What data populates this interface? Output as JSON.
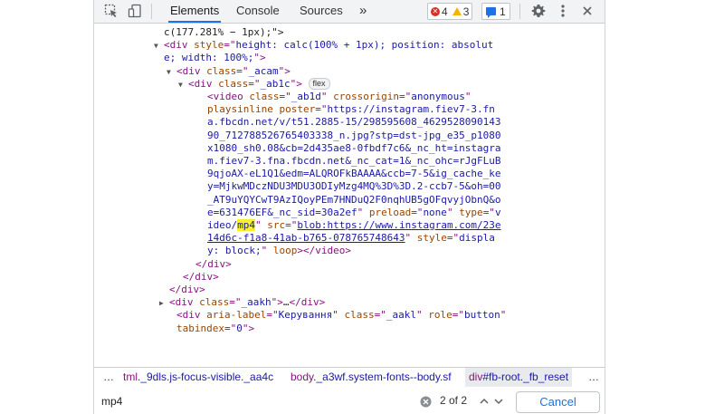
{
  "toolbar": {
    "tabs": [
      "Elements",
      "Console",
      "Sources"
    ],
    "more_tabs": "»",
    "errors": "4",
    "warnings": "3",
    "messages": "1"
  },
  "tree": [
    {
      "parts": [
        [
          "t",
          "c(177.281% − 1px);\">"
        ]
      ]
    },
    {
      "parts": [
        [
          "tri",
          "▼"
        ],
        [
          "tag",
          "<div "
        ],
        [
          "an",
          "style"
        ],
        [
          "tag",
          "=\""
        ],
        [
          "av",
          "height: calc(100% + 1px); position: absolut"
        ]
      ]
    },
    {
      "parts": [
        [
          "av",
          "e; width: 100%;"
        ],
        [
          "tag",
          "\">"
        ]
      ]
    },
    {
      "parts": [
        [
          "tri",
          "▼"
        ],
        [
          "tag",
          "<div "
        ],
        [
          "an",
          "class"
        ],
        [
          "tag",
          "=\""
        ],
        [
          "av",
          "_acam"
        ],
        [
          "tag",
          "\">"
        ]
      ]
    },
    {
      "parts": [
        [
          "tri",
          "▼"
        ],
        [
          "tag",
          "<div "
        ],
        [
          "an",
          "class"
        ],
        [
          "tag",
          "=\""
        ],
        [
          "av",
          "_ab1c"
        ],
        [
          "tag",
          "\">"
        ],
        [
          "t",
          " "
        ],
        [
          "pill",
          "flex"
        ]
      ]
    },
    {
      "parts": [
        [
          "tag",
          "<video "
        ],
        [
          "an",
          "class"
        ],
        [
          "tag",
          "=\""
        ],
        [
          "av",
          "_ab1d"
        ],
        [
          "tag",
          "\" "
        ],
        [
          "an",
          "crossorigin"
        ],
        [
          "tag",
          "=\""
        ],
        [
          "av",
          "anonymous"
        ],
        [
          "tag",
          "\""
        ]
      ]
    },
    {
      "parts": [
        [
          "an",
          "playsinline "
        ],
        [
          "an",
          "poster"
        ],
        [
          "tag",
          "=\""
        ],
        [
          "av",
          "https://instagram.fiev7-3.fn"
        ]
      ]
    },
    {
      "parts": [
        [
          "av",
          "a.fbcdn.net/v/t51.2885-15/298595608_4629528090143"
        ]
      ]
    },
    {
      "parts": [
        [
          "av",
          "90_712788526765403338_n.jpg?stp=dst-jpg_e35_p1080"
        ]
      ]
    },
    {
      "parts": [
        [
          "av",
          "x1080_sh0.08&cb=2d435ae8-0fbdf7c6&_nc_ht=instagra"
        ]
      ]
    },
    {
      "parts": [
        [
          "av",
          "m.fiev7-3.fna.fbcdn.net&_nc_cat=1&_nc_ohc=rJgFLuB"
        ]
      ]
    },
    {
      "parts": [
        [
          "av",
          "9qjoAX-eL1Q1&edm=ALQROFkBAAAA&ccb=7-5&ig_cache_ke"
        ]
      ]
    },
    {
      "parts": [
        [
          "av",
          "y=MjkwMDczNDU3MDU3ODIyMzg4MQ%3D%3D.2-ccb7-5&oh=00"
        ]
      ]
    },
    {
      "parts": [
        [
          "av",
          "_AT9uYQYCwT9AzIQoyPEm7HNDuQ2F0nqhUB5gOFqvyjObnQ&o"
        ]
      ]
    },
    {
      "parts": [
        [
          "av",
          "e=631476EF&_nc_sid=30a2ef"
        ],
        [
          "tag",
          "\" "
        ],
        [
          "an",
          "preload"
        ],
        [
          "tag",
          "=\""
        ],
        [
          "av",
          "none"
        ],
        [
          "tag",
          "\" "
        ],
        [
          "an",
          "type"
        ],
        [
          "tag",
          "=\""
        ],
        [
          "av",
          "v"
        ]
      ]
    },
    {
      "parts": [
        [
          "av",
          "ideo/"
        ],
        [
          "hl",
          "mp4"
        ],
        [
          "tag",
          "\" "
        ],
        [
          "an",
          "src"
        ],
        [
          "tag",
          "=\""
        ],
        [
          "link",
          "blob:https://www.instagram.com/23e"
        ]
      ]
    },
    {
      "parts": [
        [
          "link",
          "14d6c-f1a8-41ab-b765-078765748643"
        ],
        [
          "tag",
          "\" "
        ],
        [
          "an",
          "style"
        ],
        [
          "tag",
          "=\""
        ],
        [
          "av",
          "displa"
        ]
      ]
    },
    {
      "parts": [
        [
          "av",
          "y: block;"
        ],
        [
          "tag",
          "\" "
        ],
        [
          "an",
          "loop"
        ],
        [
          "tag",
          "></video>"
        ]
      ]
    },
    {
      "parts": [
        [
          "tag",
          "</div>"
        ]
      ]
    },
    {
      "parts": [
        [
          "tag",
          "</div>"
        ]
      ]
    },
    {
      "parts": [
        [
          "tag",
          "</div>"
        ]
      ]
    },
    {
      "parts": [
        [
          "tri",
          "▶"
        ],
        [
          "tag",
          "<div "
        ],
        [
          "an",
          "class"
        ],
        [
          "tag",
          "=\""
        ],
        [
          "av",
          "_aakh"
        ],
        [
          "tag",
          "\">"
        ],
        [
          "t",
          "…"
        ],
        [
          "tag",
          "</div>"
        ]
      ]
    },
    {
      "parts": [
        [
          "tag",
          "<div "
        ],
        [
          "an",
          "aria-label"
        ],
        [
          "tag",
          "=\""
        ],
        [
          "av",
          "Керування"
        ],
        [
          "tag",
          "\" "
        ],
        [
          "an",
          "class"
        ],
        [
          "tag",
          "=\""
        ],
        [
          "av",
          "_aakl"
        ],
        [
          "tag",
          "\" "
        ],
        [
          "an",
          "role"
        ],
        [
          "tag",
          "=\""
        ],
        [
          "av",
          "button"
        ],
        [
          "tag",
          "\""
        ]
      ]
    },
    {
      "parts": [
        [
          "an",
          "tabindex"
        ],
        [
          "tag",
          "=\""
        ],
        [
          "av",
          "0"
        ],
        [
          "tag",
          "\">"
        ]
      ]
    }
  ],
  "breadcrumbs": [
    {
      "tag": "…",
      "cls": ""
    },
    {
      "tag": "tml",
      "cls": "._9dls.js-focus-visible._aa4c"
    },
    {
      "tag": "body",
      "cls": "._a3wf.system-fonts--body.sf"
    },
    {
      "tag": "div",
      "cls": "#fb-root._fb_reset"
    }
  ],
  "search": {
    "query": "mp4",
    "match_count": "2 of 2",
    "cancel_label": "Cancel"
  }
}
